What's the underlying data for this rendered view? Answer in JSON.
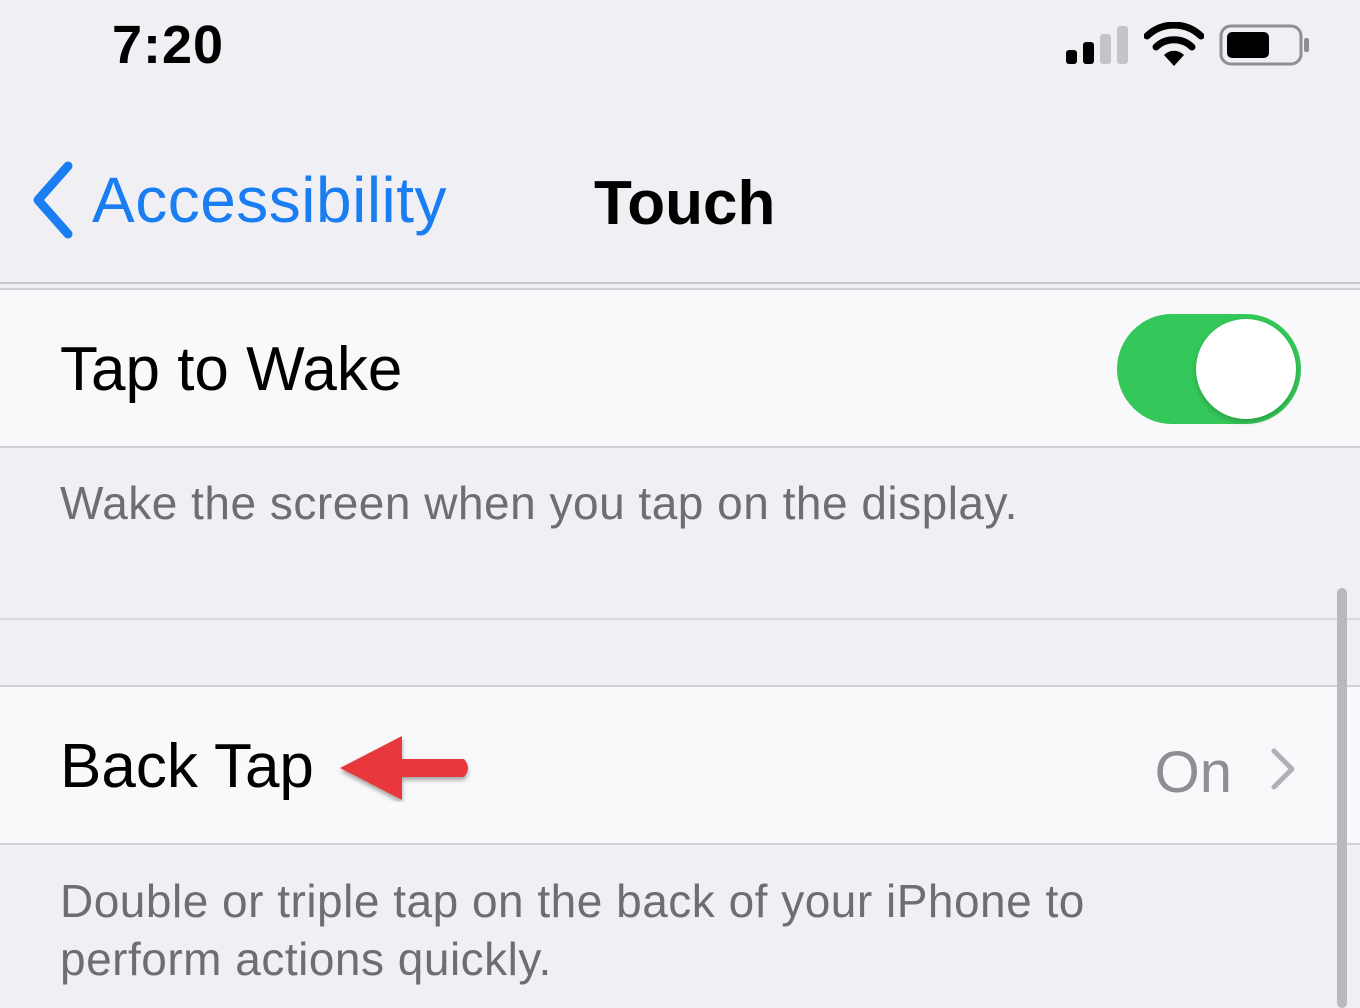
{
  "status_bar": {
    "time": "7:20",
    "signal_icon": "cellular-signal-icon",
    "wifi_icon": "wifi-icon",
    "battery_icon": "battery-icon"
  },
  "nav": {
    "back_label": "Accessibility",
    "title": "Touch",
    "back_icon": "chevron-left-icon",
    "accent_color": "#1a7ef2"
  },
  "tap_to_wake": {
    "label": "Tap to Wake",
    "toggle_on": true,
    "toggle_color": "#34c759",
    "footer": "Wake the screen when you tap on the display."
  },
  "back_tap": {
    "label": "Back Tap",
    "value": "On",
    "disclosure_icon": "chevron-right-icon",
    "footer": "Double or triple tap on the back of your iPhone to perform actions quickly."
  },
  "annotation": {
    "arrow_icon": "red-arrow-icon",
    "arrow_color": "#e8393c"
  }
}
